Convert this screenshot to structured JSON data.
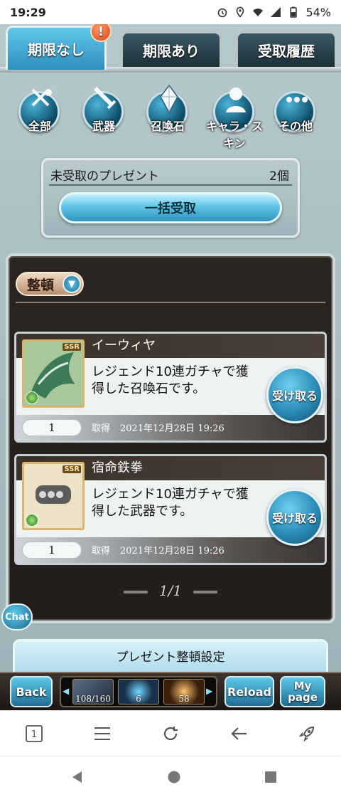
{
  "status_bar": {
    "time": "19:29",
    "battery": "54%",
    "icons": [
      "alarm-icon",
      "location-icon",
      "wifi-icon",
      "signal-icon",
      "battery-icon"
    ]
  },
  "tabs": [
    {
      "label": "期限なし",
      "badge": "!"
    },
    {
      "label": "期限あり"
    },
    {
      "label": "受取履歴"
    }
  ],
  "categories": [
    {
      "label": "全部",
      "icon": "all-items-icon"
    },
    {
      "label": "武器",
      "icon": "sword-icon"
    },
    {
      "label": "召喚石",
      "icon": "crystal-icon"
    },
    {
      "label": "キャラ・スキン",
      "icon": "character-icon"
    },
    {
      "label": "その他",
      "icon": "more-icon"
    }
  ],
  "unclaimed": {
    "label": "未受取のプレゼント",
    "count": "2個",
    "claim_all_label": "一括受取"
  },
  "sort_label": "整頓",
  "items": [
    {
      "name": "イーウィヤ",
      "rarity": "SSR",
      "description": "レジェンド10連ガチャで獲得した召喚石です。",
      "quantity": "1",
      "obtained_label": "取得",
      "date": "2021年12月28日 19:26",
      "receive_label": "受け取る"
    },
    {
      "name": "宿命鉄拳",
      "rarity": "SSR",
      "description": "レジェンド10連ガチャで獲得した武器です。",
      "quantity": "1",
      "obtained_label": "取得",
      "date": "2021年12月28日 19:26",
      "receive_label": "受け取る"
    }
  ],
  "pager": "1/1",
  "chat_label": "Chat",
  "settings_label": "プレゼント整頓設定",
  "game_nav": {
    "back": "Back",
    "thumb_values": [
      "108/160",
      "6",
      "58"
    ],
    "reload": "Reload",
    "mypage": "My page"
  },
  "browser_toolbar": {
    "tab_count": "1",
    "icons": [
      "tabs-icon",
      "menu-icon",
      "refresh-icon",
      "back-arrow-icon",
      "rocket-icon"
    ]
  },
  "colors": {
    "accent_blue": "#2e8fbd",
    "panel_dark": "#2b2521",
    "background": "#a4babf"
  }
}
